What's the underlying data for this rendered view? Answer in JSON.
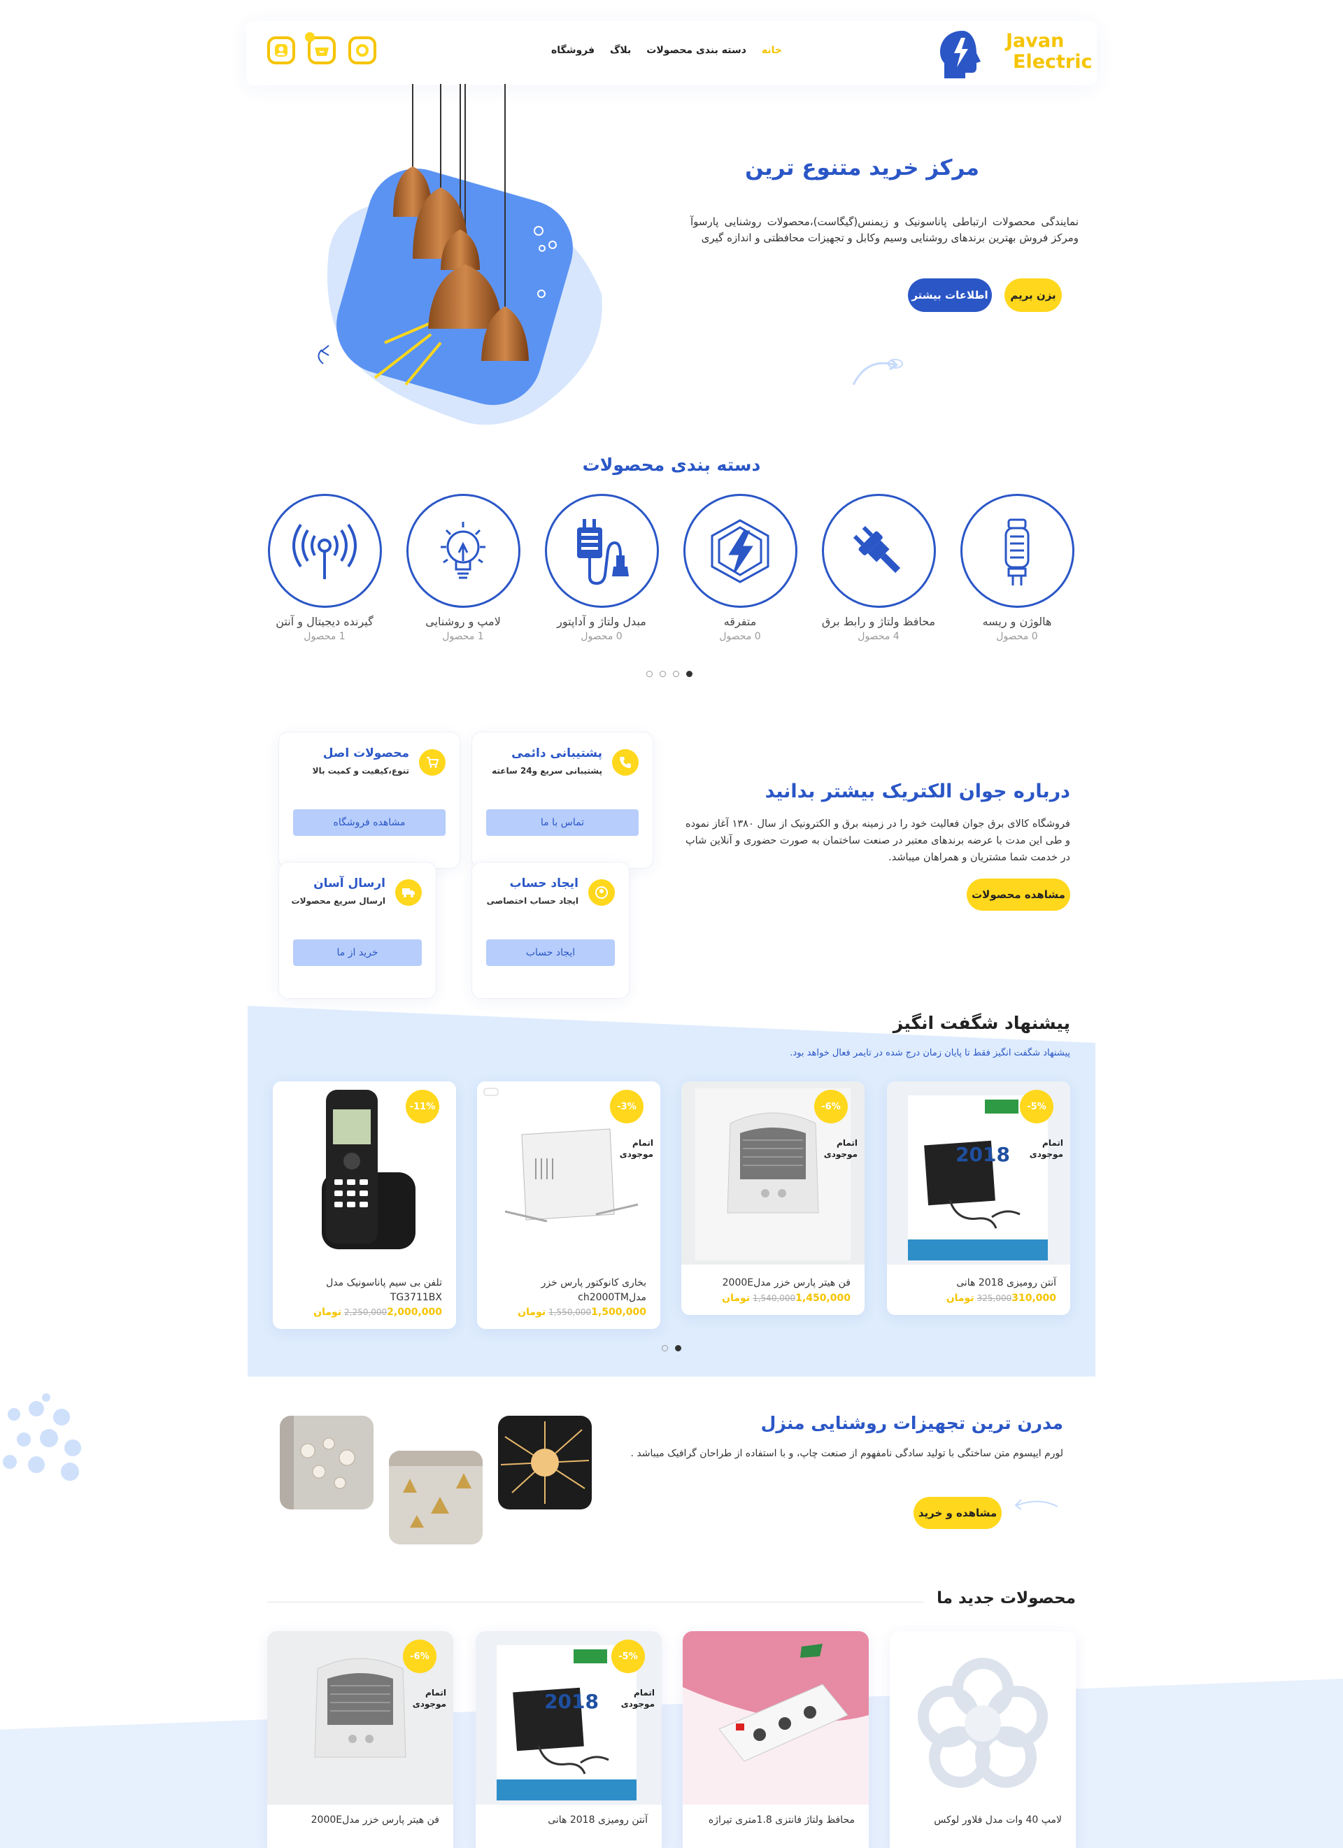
{
  "header": {
    "logo_line1": "Javan",
    "logo_line2": "Electric",
    "nav": [
      "خانه",
      "دسته بندی محصولات",
      "بلاگ",
      "فروشگاه"
    ],
    "icons": [
      "user-icon",
      "basket-icon",
      "search-icon"
    ]
  },
  "hero": {
    "title": "مرکز خرید متنوع ترین",
    "description": "نمایندگی محصولات ارتباطی پاناسونیک و زیمنس(گیگاست)،محصولات روشنایی پارسوآ ومرکز فروش بهترین برندهای روشنایی وسیم وکابل و تجهیزات محافظتی و اندازه گیری",
    "btn_go": "بزن بریم",
    "btn_more": "اطلاعات بیشتر"
  },
  "categories": {
    "title": "دسته بندی محصولات",
    "items": [
      {
        "name": "هالوژن و ریسه",
        "count": "0 محصول",
        "icon": "halogen-icon"
      },
      {
        "name": "محافظ ولتاژ و رابط برق",
        "count": "4 محصول",
        "icon": "plug-icon"
      },
      {
        "name": "متفرقه",
        "count": "0 محصول",
        "icon": "lightning-icon"
      },
      {
        "name": "مبدل ولتاژ و آداپتور",
        "count": "0 محصول",
        "icon": "adapter-icon"
      },
      {
        "name": "لامپ و روشنایی",
        "count": "1 محصول",
        "icon": "bulb-icon"
      },
      {
        "name": "گیرنده دیجیتال و آنتن",
        "count": "1 محصول",
        "icon": "antenna-icon"
      }
    ]
  },
  "about": {
    "title": "درباره جوان الکتریک بیشتر بدانید",
    "text": "فروشگاه کالای برق جوان فعالیت خود را در زمینه برق و الکترونیک از سال ۱۳۸۰ آغاز نموده و طی این مدت با عرضه برندهای معتبر در صنعت ساختمان به صورت حضوری و آنلاین شاپ در خدمت شما مشتریان و همراهان میباشد.",
    "button": "مشاهده محصولات",
    "features": [
      {
        "title": "پشتیبانی دائمی",
        "subtitle": "پشتیبانی سریع و24 ساعته",
        "button": "تماس با ما",
        "icon": "phone-icon"
      },
      {
        "title": "محصولات اصل",
        "subtitle": "تنوع،کیفیت و کمیت بالا",
        "button": "مشاهده فروشگاه",
        "icon": "cart-icon"
      },
      {
        "title": "ایجاد حساب",
        "subtitle": "ایجاد حساب اختصاصی",
        "button": "ایجاد حساب",
        "icon": "account-icon"
      },
      {
        "title": "ارسال آسان",
        "subtitle": "ارسال سریع محصولات",
        "button": "خرید از ما",
        "icon": "truck-icon"
      }
    ]
  },
  "offers": {
    "title": "پیشنهاد شگفت انگیز",
    "subtitle": "پیشنهاد شگفت انگیز فقط تا پایان زمان درج شده در تایمر فعال خواهد بود.",
    "soldout": "اتمام موجودی",
    "products": [
      {
        "name": "آنتن رومیزی 2018 هانی",
        "old": "325,000",
        "price": "310,000تومان",
        "discount": "-5%",
        "soldout": true
      },
      {
        "name": "فن هیتر پارس خزر مدل2000E",
        "old": "1,540,000",
        "price": "1,450,000تومان",
        "discount": "-6%",
        "soldout": true
      },
      {
        "name": "بخاری کانوکتور پارس خزر مدلch2000TM",
        "old": "1,550,000",
        "price": "1,500,000تومان",
        "discount": "-3%",
        "soldout": true
      },
      {
        "name": "تلفن بی سیم پاناسونیک مدل TG3711BX",
        "old": "2,250,000",
        "price": "2,000,000تومان",
        "discount": "-11%",
        "soldout": false
      }
    ]
  },
  "lighting": {
    "title": "مدرن ترین تجهیزات روشنایی منزل",
    "text": "لورم ایپسوم متن ساختگی با تولید سادگی نامفهوم از صنعت چاپ، و با استفاده از طراحان گرافیک میباشد .",
    "button": "مشاهده و خرید"
  },
  "new_products": {
    "title": "محصولات جدید ما",
    "items": [
      {
        "name": "لامپ 40 وات مدل فلاور لوکس",
        "discount": ""
      },
      {
        "name": "محافظ ولتاژ فانتزی 1.8متری تیراژه",
        "discount": ""
      },
      {
        "name": "آنتن رومیزی 2018 هانی",
        "discount": "-5%"
      },
      {
        "name": "فن هیتر پارس خزر مدل2000E",
        "discount": "-6%"
      }
    ]
  },
  "colors": {
    "primary": "#2a56c6",
    "accent": "#ffd71c",
    "light_bg": "#deecfd"
  }
}
